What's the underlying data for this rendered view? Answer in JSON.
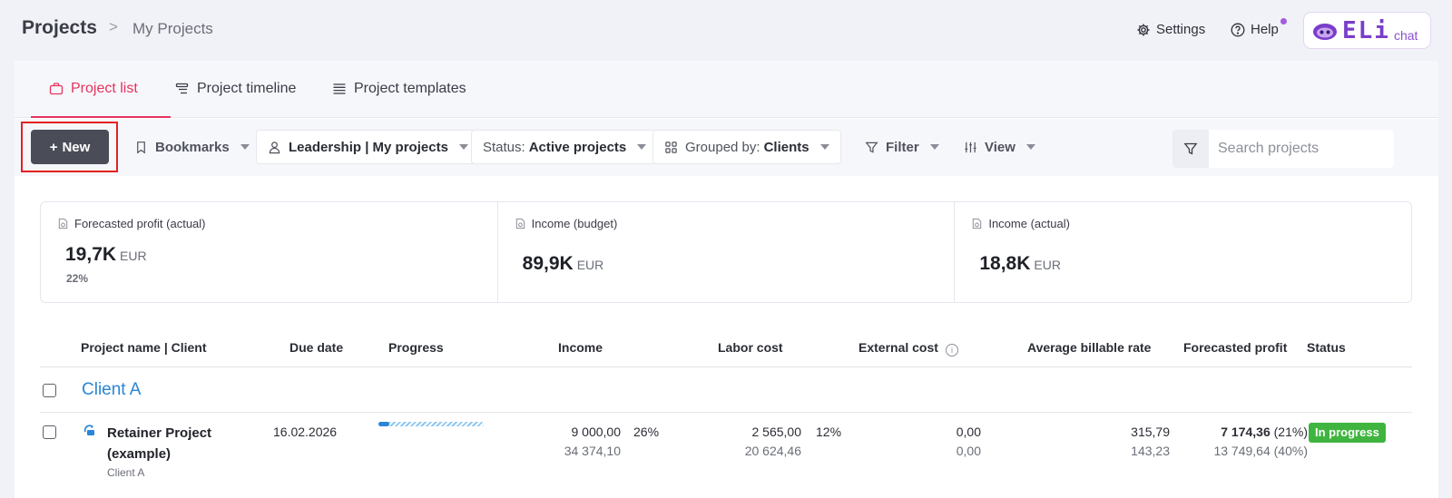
{
  "header": {
    "title": "Projects",
    "separator": ">",
    "subtitle": "My Projects",
    "settings_label": "Settings",
    "help_label": "Help",
    "eli_logo": "ELi",
    "eli_suffix": "chat"
  },
  "tabs": [
    {
      "label": "Project list",
      "icon": "briefcase-icon",
      "active": true
    },
    {
      "label": "Project timeline",
      "icon": "timeline-icon",
      "active": false
    },
    {
      "label": "Project templates",
      "icon": "list-icon",
      "active": false
    }
  ],
  "toolbar": {
    "new_label": "New",
    "new_prefix": "+",
    "bookmarks_label": "Bookmarks",
    "view_selector": "Leadership | My projects",
    "status_prefix": "Status:",
    "status_value": "Active projects",
    "grouped_prefix": "Grouped by:",
    "grouped_value": "Clients",
    "filter_label": "Filter",
    "view_label": "View",
    "search_placeholder": "Search projects"
  },
  "kpis": [
    {
      "label": "Forecasted profit (actual)",
      "value": "19,7K",
      "unit": "EUR",
      "pct": "22%"
    },
    {
      "label": "Income (budget)",
      "value": "89,9K",
      "unit": "EUR"
    },
    {
      "label": "Income (actual)",
      "value": "18,8K",
      "unit": "EUR"
    }
  ],
  "table": {
    "columns": {
      "name": "Project name | Client",
      "due": "Due date",
      "progress": "Progress",
      "income": "Income",
      "labor": "Labor cost",
      "external": "External cost",
      "rate": "Average billable rate",
      "profit": "Forecasted profit",
      "status": "Status"
    },
    "groups": [
      {
        "name": "Client A",
        "rows": [
          {
            "name": "Retainer Project (example)",
            "client": "Client A",
            "due": "16.02.2026",
            "progress": 0.1,
            "income_main": "9 000,00",
            "income_sub": "34 374,10",
            "income_pct": "26%",
            "labor_main": "2 565,00",
            "labor_sub": "20 624,46",
            "labor_pct": "12%",
            "external_main": "0,00",
            "external_sub": "0,00",
            "rate_main": "315,79",
            "rate_sub": "143,23",
            "profit_main": "7 174,36",
            "profit_main_pct": "(21%)",
            "profit_sub": "13 749,64 (40%)",
            "status": "In progress"
          }
        ]
      }
    ]
  },
  "colors": {
    "accent": "#e6335e",
    "link": "#2a86d6",
    "status_green": "#3fb53f",
    "new_button": "#4a4d57"
  }
}
